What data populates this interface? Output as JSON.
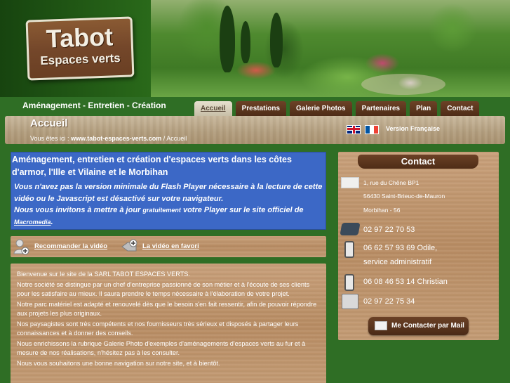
{
  "logo": {
    "title": "Tabot",
    "subtitle": "Espaces verts"
  },
  "tagline": "Aménagement - Entretien - Création",
  "nav": [
    "Accueil",
    "Prestations",
    "Galerie Photos",
    "Partenaires",
    "Plan",
    "Contact"
  ],
  "banner": {
    "heading": "Accueil",
    "breadcrumb_prefix": "Vous êtes ici : ",
    "breadcrumb_site": "www.tabot-espaces-verts.com",
    "breadcrumb_sep": " / ",
    "breadcrumb_page": "Accueil",
    "language_label": "Version Française"
  },
  "intro": {
    "title": "Aménagement, entretien et création d'espaces verts dans les côtes d'armor, l'Ille et Vilaine et le Morbihan",
    "flash_line1": "Vous n'avez pas la version minimale du Flash Player nécessaire à la lecture de cette vidéo ou le Javascript est désactivé sur votre navigateur.",
    "flash_line2a": "Nous vous invitons à mettre à jour ",
    "flash_free": "gratuitement",
    "flash_line2b": " votre Player sur le site officiel de ",
    "flash_link": "Macromedia",
    "flash_end": "."
  },
  "tools": {
    "recommend": "Recommander la vidéo",
    "favorite": "La vidéo en favori"
  },
  "body_text": [
    "Bienvenue sur le site de la SARL TABOT ESPACES VERTS.",
    "Notre société se distingue par un chef d'entreprise passionné de son métier et à l'écoute de ses clients pour les satisfaire au mieux. Il saura prendre le temps nécessaire à l'élaboration de votre projet.",
    "Notre parc matériel est adapté et renouvelé dès que le besoin s'en fait ressentir, afin de pouvoir répondre aux projets les plus originaux.",
    "Nos paysagistes sont très compétents et nos fournisseurs très sérieux et disposés à partager leurs connaissances et à donner des conseils.",
    "Nous enrichissons la rubrique Galerie Photo d'exemples d'aménagements d'espaces verts au fur et à mesure de nos réalisations, n'hésitez pas à les consulter.",
    "Nous vous souhaitons une bonne navigation sur notre site, et à bientôt."
  ],
  "contact": {
    "title": "Contact",
    "address1": "1, rue du Chêne BP1",
    "address2": "56430 Saint-Brieuc-de-Mauron",
    "address3": "Morbihan - 56",
    "phone": "02 97 22 70 53",
    "mobile1": "06 62 57 93 69 Odile,",
    "mobile1_who": "service administratif",
    "mobile2": "06 08 46 53 14 Christian",
    "fax": "02 97 22 75 34",
    "button": "Me Contacter par Mail"
  }
}
